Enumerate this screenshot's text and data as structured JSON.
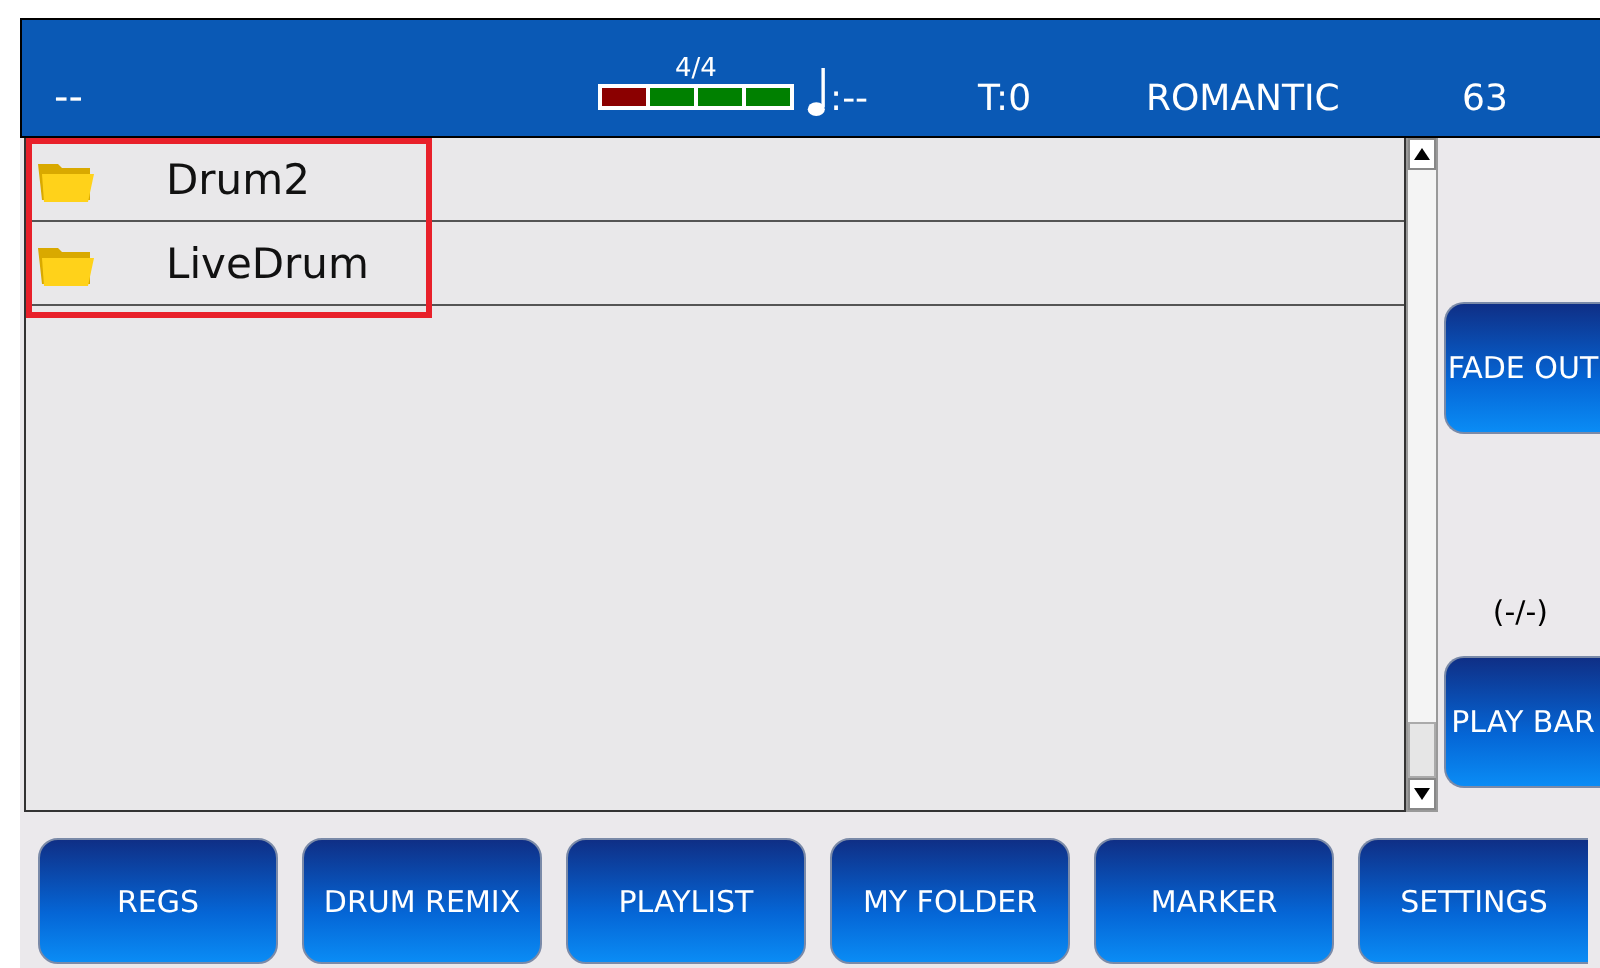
{
  "top_bar": {
    "left": "--",
    "time_signature": "4/4",
    "beats": [
      {
        "color": "#8b0000"
      },
      {
        "color": "#008000"
      },
      {
        "color": "#008000"
      },
      {
        "color": "#008000"
      }
    ],
    "tempo": ":--",
    "transpose": "T:0",
    "style": "ROMANTIC",
    "number": "63"
  },
  "list": {
    "highlight": true,
    "items": [
      {
        "name": "Drum2"
      },
      {
        "name": "LiveDrum"
      }
    ]
  },
  "side": {
    "buttons": [
      "FADE OUT",
      "PLAY BAR"
    ],
    "status": "(-/-)"
  },
  "bottom_buttons": [
    "REGS",
    "DRUM REMIX",
    "PLAYLIST",
    "MY FOLDER",
    "MARKER",
    "SETTINGS"
  ]
}
